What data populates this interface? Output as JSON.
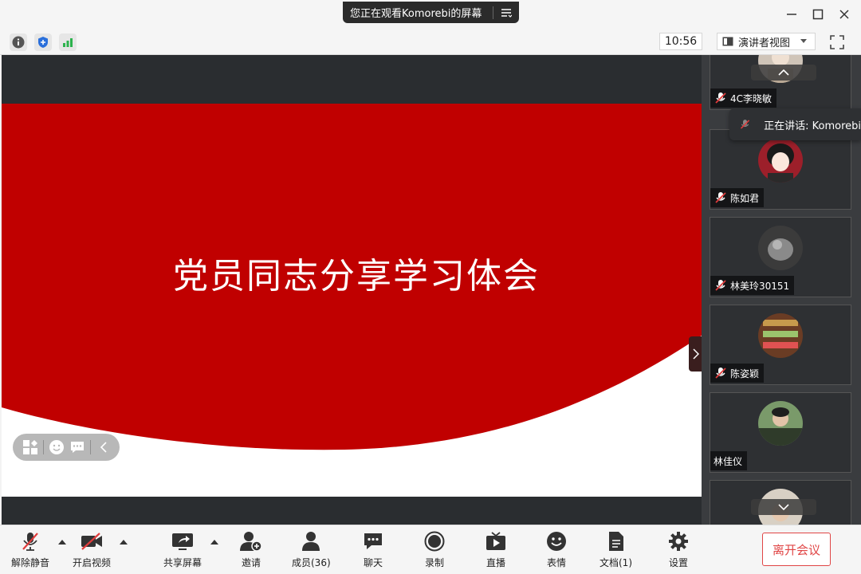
{
  "window": {
    "share_banner": "您正在观看Komorebi的屏幕",
    "controls": [
      "minimize-icon",
      "maximize-icon",
      "close-icon"
    ]
  },
  "statusbar": {
    "icons": [
      "info-icon",
      "shield-icon",
      "signal-icon"
    ],
    "time": "10:56",
    "view_mode": "演讲者视图"
  },
  "slide": {
    "title": "党员同志分享学习体会",
    "accent_color": "#c00000"
  },
  "participants": [
    {
      "name": "4C李晓敏",
      "muted": true
    },
    {
      "name": "陈如君",
      "muted": true
    },
    {
      "name": "林美玲30151",
      "muted": true
    },
    {
      "name": "陈姿颖",
      "muted": true
    },
    {
      "name": "林佳仪",
      "muted": false
    }
  ],
  "speaking": {
    "label": "正在讲话: Komorebi"
  },
  "toolbar": {
    "unmute": "解除静音",
    "start_video": "开启视频",
    "share_screen": "共享屏幕",
    "invite": "邀请",
    "members": "成员(36)",
    "chat": "聊天",
    "record": "录制",
    "live": "直播",
    "reactions": "表情",
    "docs": "文档(1)",
    "settings": "设置",
    "leave": "离开会议",
    "leave_color": "#e04545"
  }
}
